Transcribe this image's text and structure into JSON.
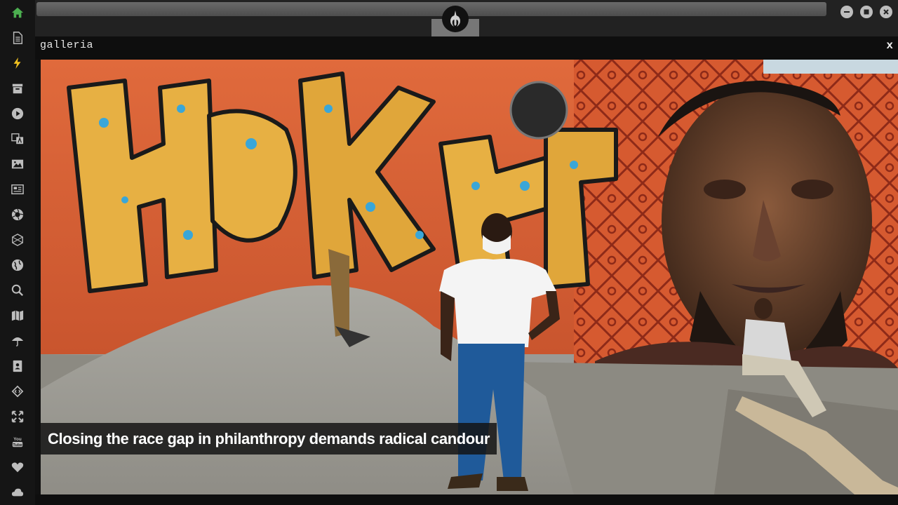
{
  "sidebar": {
    "items": [
      {
        "icon": "home-icon",
        "color": "#4caf50"
      },
      {
        "icon": "document-icon",
        "color": "#bdbdbd"
      },
      {
        "icon": "lightning-icon",
        "color": "#f0c020"
      },
      {
        "icon": "archive-icon",
        "color": "#bdbdbd"
      },
      {
        "icon": "play-icon",
        "color": "#bdbdbd"
      },
      {
        "icon": "translate-icon",
        "color": "#bdbdbd"
      },
      {
        "icon": "image-icon",
        "color": "#bdbdbd"
      },
      {
        "icon": "newspaper-icon",
        "color": "#bdbdbd"
      },
      {
        "icon": "aperture-icon",
        "color": "#bdbdbd"
      },
      {
        "icon": "hexagon-icon",
        "color": "#bdbdbd"
      },
      {
        "icon": "globe-icon",
        "color": "#bdbdbd"
      },
      {
        "icon": "search-icon",
        "color": "#bdbdbd"
      },
      {
        "icon": "map-icon",
        "color": "#bdbdbd"
      },
      {
        "icon": "umbrella-icon",
        "color": "#bdbdbd"
      },
      {
        "icon": "contact-card-icon",
        "color": "#bdbdbd"
      },
      {
        "icon": "code-icon",
        "color": "#bdbdbd"
      },
      {
        "icon": "expand-icon",
        "color": "#bdbdbd"
      },
      {
        "icon": "youtube-icon",
        "color": "#bdbdbd"
      },
      {
        "icon": "heart-icon",
        "color": "#bdbdbd"
      },
      {
        "icon": "cloud-icon",
        "color": "#bdbdbd"
      }
    ]
  },
  "window": {
    "logo_icon": "rebel-alliance-icon",
    "controls": [
      "minimize-icon",
      "maximize-icon",
      "close-icon"
    ]
  },
  "gallery": {
    "title": "galleria",
    "close_label": "x",
    "image": {
      "mural_text": "HOKI",
      "caption": "Closing the race gap in philanthropy demands radical candour"
    }
  }
}
